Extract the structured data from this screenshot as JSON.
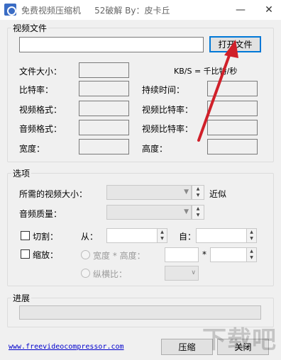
{
  "window": {
    "title": "免费视频压缩机     52破解 By：皮卡丘",
    "minimize_glyph": "—",
    "close_glyph": "✕"
  },
  "video_file": {
    "group_title": "视频文件",
    "path_value": "",
    "open_button": "打开文件",
    "rate_unit_note": "KB/S = 千比特/秒",
    "fields": {
      "file_size": "文件大小：",
      "bitrate": "比特率：",
      "video_format": "视频格式：",
      "audio_format": "音频格式：",
      "width": "宽度：",
      "duration": "持续时间：",
      "video_bitrate": "视频比特率：",
      "audio_bitrate": "视频比特率：",
      "height": "高度："
    }
  },
  "options": {
    "group_title": "选项",
    "desired_size_label": "所需的视频大小：",
    "approx_label": "近似",
    "audio_quality_label": "音频质量：",
    "crop_label": "切割：",
    "from_label": "从：",
    "to_label": "自：",
    "scale_label": "缩放：",
    "width_height_label": "宽度 * 高度：",
    "times_label": "*",
    "aspect_label": "纵横比："
  },
  "progress": {
    "group_title": "进展",
    "value": 0
  },
  "footer": {
    "link_text": "www.freevideocompressor.com",
    "compress_button": "压缩",
    "close_button": "关闭"
  },
  "watermark": {
    "text": "下载吧"
  },
  "colors": {
    "arrow": "#d0202a",
    "default_button_border": "#0078d7"
  }
}
